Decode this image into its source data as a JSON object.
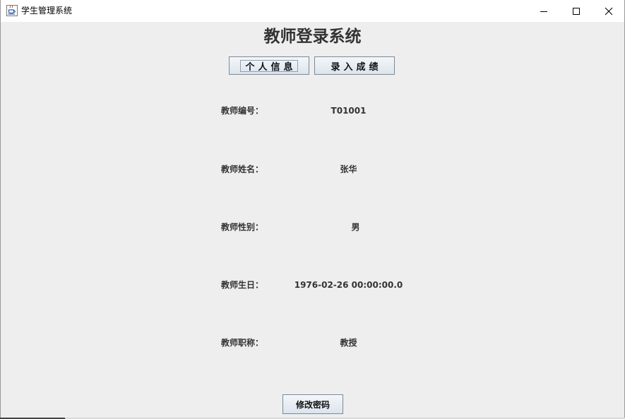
{
  "window": {
    "title": "学生管理系统",
    "icon": "java-cup-icon",
    "controls": {
      "minimize": "minimize-icon",
      "maximize": "maximize-icon",
      "close": "close-icon"
    }
  },
  "header": {
    "title": "教师登录系统"
  },
  "tabs": [
    {
      "label": "个人信息",
      "focused": true
    },
    {
      "label": "录入成绩",
      "focused": false
    }
  ],
  "profile": {
    "fields": [
      {
        "label": "教师编号：",
        "value": "T01001"
      },
      {
        "label": "教师姓名：",
        "value": "张华"
      },
      {
        "label": "教师性别：",
        "value": "男"
      },
      {
        "label": "教师生日：",
        "value": "1976-02-26 00:00:00.0"
      },
      {
        "label": "教师职称：",
        "value": "教授"
      }
    ]
  },
  "actions": {
    "change_password_label": "修改密码"
  },
  "colors": {
    "window_bg": "#eeeeee",
    "titlebar_bg": "#ffffff",
    "text": "#333333",
    "button_border": "#7a8a9a"
  }
}
